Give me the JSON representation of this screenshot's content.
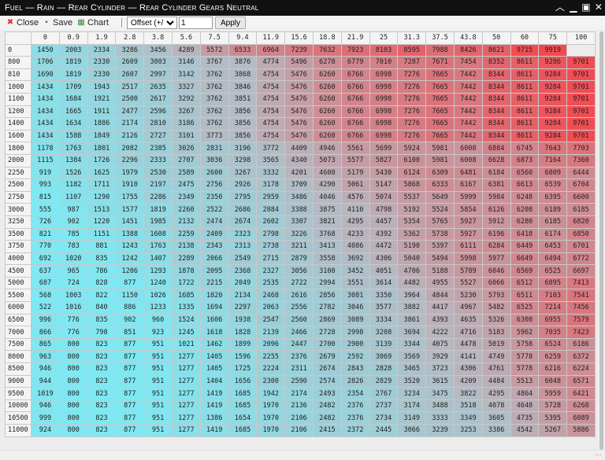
{
  "window": {
    "title": "Fuel — Rain — Rear Cylinder — Rear Cylinder Gears Neutral"
  },
  "toolbar": {
    "close_label": "Close",
    "save_label": "Save",
    "chart_label": "Chart",
    "offset_select": "Offset (+/-)",
    "value_input": "1",
    "apply_label": "Apply"
  },
  "table": {
    "columns": [
      "0",
      "0.9",
      "1.9",
      "2.8",
      "3.8",
      "5.6",
      "7.5",
      "9.4",
      "11.9",
      "15.6",
      "18.8",
      "21.9",
      "25",
      "31.3",
      "37.5",
      "43.8",
      "50",
      "60",
      "75",
      "100"
    ],
    "rows": [
      {
        "rpm": "0",
        "values": [
          1450,
          2003,
          2334,
          3286,
          3456,
          4289,
          5572,
          6533,
          6964,
          7239,
          7632,
          7923,
          8103,
          8595,
          7988,
          8426,
          8621,
          9715,
          9919
        ]
      },
      {
        "rpm": "800",
        "values": [
          1706,
          1819,
          2330,
          2609,
          3003,
          3146,
          3767,
          3876,
          4774,
          5496,
          6278,
          6779,
          7010,
          7287,
          7671,
          7454,
          8352,
          8611,
          9286,
          9701
        ]
      },
      {
        "rpm": "810",
        "values": [
          1690,
          1819,
          2330,
          2607,
          2997,
          3142,
          3762,
          3868,
          4754,
          5476,
          6260,
          6766,
          6998,
          7276,
          7665,
          7442,
          8344,
          8611,
          9284,
          9701
        ]
      },
      {
        "rpm": "1000",
        "values": [
          1434,
          1709,
          1943,
          2517,
          2635,
          3327,
          3762,
          3846,
          4754,
          5476,
          6260,
          6766,
          6998,
          7276,
          7665,
          7442,
          8344,
          8611,
          9284,
          9701
        ]
      },
      {
        "rpm": "1100",
        "values": [
          1434,
          1684,
          1921,
          2500,
          2617,
          3292,
          3762,
          3851,
          4754,
          5476,
          6260,
          6766,
          6998,
          7276,
          7665,
          7442,
          8344,
          8611,
          9284,
          9701
        ]
      },
      {
        "rpm": "1200",
        "values": [
          1434,
          1665,
          1911,
          2477,
          2596,
          3267,
          3762,
          3856,
          4754,
          5476,
          6260,
          6766,
          6998,
          7276,
          7665,
          7442,
          8344,
          8611,
          9284,
          9701
        ]
      },
      {
        "rpm": "1400",
        "values": [
          1434,
          1634,
          1886,
          2174,
          2810,
          3186,
          3762,
          3856,
          4754,
          5476,
          6260,
          6766,
          6998,
          7276,
          7665,
          7442,
          8344,
          8611,
          9284,
          9701
        ]
      },
      {
        "rpm": "1600",
        "values": [
          1434,
          1588,
          1849,
          2126,
          2727,
          3101,
          3773,
          3856,
          4754,
          5476,
          6260,
          6766,
          6998,
          7276,
          7665,
          7442,
          8344,
          8611,
          9284,
          9701
        ]
      },
      {
        "rpm": "1800",
        "values": [
          1178,
          1763,
          1801,
          2082,
          2385,
          3026,
          2831,
          3196,
          3772,
          4409,
          4946,
          5561,
          5699,
          5924,
          5981,
          6008,
          6884,
          6745,
          7643,
          7703
        ]
      },
      {
        "rpm": "2000",
        "values": [
          1115,
          1384,
          1726,
          2296,
          2333,
          2707,
          3036,
          3298,
          3565,
          4340,
          5073,
          5577,
          5827,
          6100,
          5981,
          6008,
          6628,
          6873,
          7164,
          7360
        ]
      },
      {
        "rpm": "2250",
        "values": [
          919,
          1526,
          1625,
          1979,
          2530,
          2589,
          2600,
          3267,
          3332,
          4201,
          4608,
          5179,
          5430,
          6124,
          6309,
          6481,
          6184,
          6560,
          6809,
          6444
        ]
      },
      {
        "rpm": "2500",
        "values": [
          993,
          1182,
          1711,
          1910,
          2197,
          2475,
          2756,
          2926,
          3178,
          3709,
          4290,
          5061,
          5147,
          5868,
          6333,
          6167,
          6381,
          6613,
          6539,
          6704
        ]
      },
      {
        "rpm": "2750",
        "values": [
          815,
          1107,
          1290,
          1755,
          2286,
          2349,
          2350,
          2795,
          2959,
          3486,
          4046,
          4576,
          5074,
          5537,
          5649,
          5999,
          5984,
          6248,
          6395,
          6600
        ]
      },
      {
        "rpm": "3000",
        "values": [
          555,
          987,
          1513,
          1577,
          1819,
          2260,
          2522,
          2686,
          2884,
          3388,
          3875,
          4110,
          4798,
          5192,
          5524,
          5854,
          6126,
          6208,
          6189,
          6185
        ]
      },
      {
        "rpm": "3250",
        "values": [
          726,
          902,
          1220,
          1451,
          1985,
          2132,
          2474,
          2674,
          2602,
          3307,
          3821,
          4295,
          4457,
          5354,
          5765,
          5927,
          5912,
          6280,
          6185,
          6820
        ]
      },
      {
        "rpm": "3500",
        "values": [
          821,
          785,
          1151,
          1388,
          1608,
          2259,
          2409,
          2323,
          2798,
          3226,
          3768,
          4233,
          4392,
          5362,
          5738,
          5927,
          6196,
          6418,
          6174,
          6850
        ]
      },
      {
        "rpm": "3750",
        "values": [
          770,
          783,
          881,
          1243,
          1763,
          2138,
          2343,
          2313,
          2738,
          3211,
          3413,
          4086,
          4472,
          5190,
          5397,
          6111,
          6284,
          6449,
          6453,
          6701
        ]
      },
      {
        "rpm": "4000",
        "values": [
          692,
          1020,
          835,
          1242,
          1407,
          2289,
          2066,
          2549,
          2715,
          2879,
          3558,
          3692,
          4306,
          5040,
          5494,
          5998,
          5977,
          6649,
          6494,
          6772
        ]
      },
      {
        "rpm": "4500",
        "values": [
          637,
          965,
          786,
          1206,
          1293,
          1878,
          2095,
          2368,
          2327,
          3056,
          3100,
          3452,
          4051,
          4706,
          5188,
          5789,
          6046,
          6569,
          6525,
          6697
        ]
      },
      {
        "rpm": "5000",
        "values": [
          687,
          724,
          828,
          877,
          1240,
          1722,
          2215,
          2049,
          2535,
          2722,
          2994,
          3551,
          3614,
          4482,
          4955,
          5527,
          6066,
          6512,
          6895,
          7413
        ]
      },
      {
        "rpm": "5500",
        "values": [
          568,
          1003,
          822,
          1150,
          1026,
          1685,
          1820,
          2134,
          2468,
          2616,
          2856,
          3081,
          3350,
          3964,
          4844,
          5230,
          5793,
          6511,
          7103,
          7541
        ]
      },
      {
        "rpm": "6000",
        "values": [
          522,
          1016,
          840,
          886,
          1233,
          1335,
          1694,
          2297,
          2063,
          2556,
          2782,
          3046,
          3577,
          3882,
          4417,
          4967,
          5482,
          6525,
          7214,
          7456
        ]
      },
      {
        "rpm": "6500",
        "values": [
          996,
          776,
          835,
          902,
          960,
          1524,
          1606,
          1938,
          2547,
          2560,
          2869,
          3089,
          3334,
          3861,
          4393,
          4635,
          5326,
          6308,
          6955,
          7579
        ]
      },
      {
        "rpm": "7000",
        "values": [
          866,
          776,
          798,
          851,
          923,
          1245,
          1618,
          1828,
          2139,
          2466,
          2728,
          2998,
          3208,
          3694,
          4222,
          4716,
          5183,
          5962,
          7035,
          7423
        ]
      },
      {
        "rpm": "7500",
        "values": [
          865,
          800,
          823,
          877,
          951,
          1021,
          1462,
          1899,
          2096,
          2447,
          2700,
          2900,
          3139,
          3344,
          4075,
          4478,
          5019,
          5758,
          6524,
          6186
        ]
      },
      {
        "rpm": "8000",
        "values": [
          963,
          800,
          823,
          877,
          951,
          1277,
          1405,
          1596,
          2255,
          2376,
          2679,
          2592,
          3069,
          3569,
          3929,
          4141,
          4749,
          5778,
          6259,
          6372
        ]
      },
      {
        "rpm": "8500",
        "values": [
          946,
          800,
          823,
          877,
          951,
          1277,
          1405,
          1725,
          2224,
          2311,
          2674,
          2843,
          2828,
          3465,
          3723,
          4306,
          4761,
          5778,
          6216,
          6224
        ]
      },
      {
        "rpm": "9000",
        "values": [
          944,
          800,
          823,
          877,
          951,
          1277,
          1404,
          1656,
          2300,
          2590,
          2574,
          2826,
          2829,
          3520,
          3615,
          4209,
          4484,
          5513,
          6048,
          6571
        ]
      },
      {
        "rpm": "9500",
        "values": [
          1019,
          800,
          823,
          877,
          951,
          1277,
          1419,
          1685,
          1942,
          2174,
          2493,
          2354,
          2767,
          3234,
          3475,
          3822,
          4295,
          4864,
          5959,
          6421
        ]
      },
      {
        "rpm": "10000",
        "values": [
          946,
          800,
          823,
          877,
          951,
          1277,
          1419,
          1685,
          1970,
          2136,
          2482,
          2376,
          2737,
          3174,
          3488,
          3518,
          4078,
          4648,
          5728,
          6268
        ]
      },
      {
        "rpm": "10500",
        "values": [
          999,
          800,
          823,
          877,
          951,
          1277,
          1386,
          1654,
          1970,
          2106,
          2482,
          2376,
          2734,
          3149,
          3333,
          3349,
          3605,
          4735,
          5395,
          6089
        ]
      },
      {
        "rpm": "11000",
        "values": [
          924,
          800,
          823,
          877,
          951,
          1277,
          1419,
          1685,
          1970,
          2106,
          2415,
          2372,
          2445,
          3066,
          3239,
          3253,
          3386,
          4542,
          5267,
          5886
        ]
      }
    ]
  },
  "colors": {
    "low": "#7fe8f2",
    "mid": "#b6b9c2",
    "high": "#f2494f",
    "header_bg": "#f4f4f4",
    "title_bg": "#111111"
  },
  "icons": [
    "close-icon",
    "save-icon",
    "chart-icon",
    "minimize-icon",
    "collapse-icon",
    "maximize-icon",
    "window-close-icon"
  ]
}
